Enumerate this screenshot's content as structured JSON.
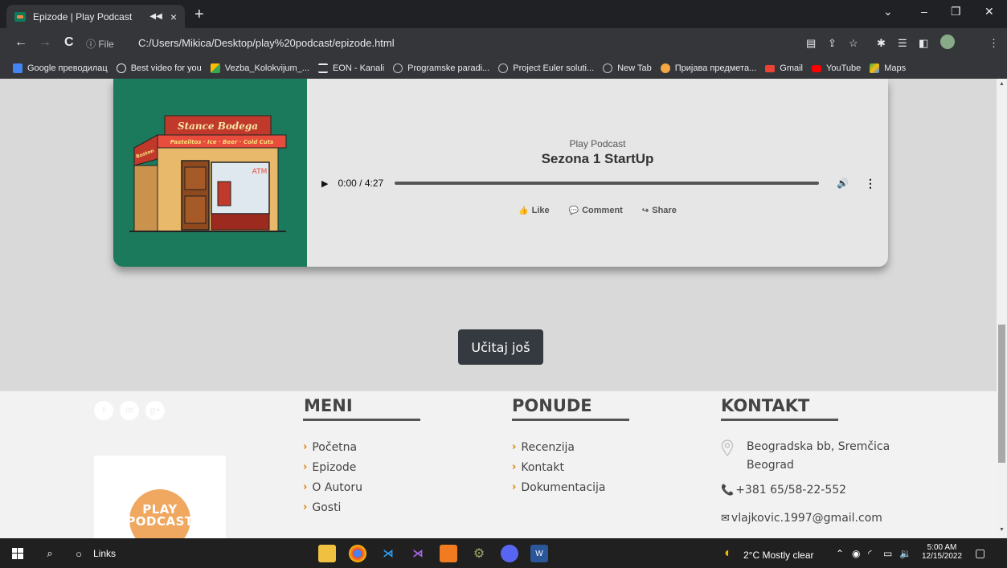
{
  "browser": {
    "tab_title": "Epizode | Play Podcast",
    "tab_audio_icon": "speaker-icon",
    "tab_close": "×",
    "new_tab": "+",
    "window_controls": [
      "⌄",
      "–",
      "❐",
      "✕"
    ],
    "nav": {
      "back": "←",
      "forward": "→",
      "reload": "C"
    },
    "url_info": "ⓘ File",
    "url": "C:/Users/Mikica/Desktop/play%20podcast/epizode.html"
  },
  "bookmarks": [
    {
      "label": "Google преводилац",
      "color": "#4285f4"
    },
    {
      "label": "Best video for you",
      "color": "#35363a"
    },
    {
      "label": "Vezba_Kolokvijum_...",
      "color": "#fbbc04"
    },
    {
      "label": "EON - Kanali",
      "color": "#35363a"
    },
    {
      "label": "Programske paradi...",
      "color": "#35363a"
    },
    {
      "label": "Project Euler soluti...",
      "color": "#35363a"
    },
    {
      "label": "New Tab",
      "color": "#35363a"
    },
    {
      "label": "Пријава предмета...",
      "color": "#f4a742"
    },
    {
      "label": "Gmail",
      "color": "#ea4335"
    },
    {
      "label": "YouTube",
      "color": "#ff0000"
    },
    {
      "label": "Maps",
      "color": "#34a853"
    }
  ],
  "episode": {
    "subtitle": "Play Podcast",
    "title": "Sezona 1 StartUp",
    "audio": {
      "time": "0:00 / 4:27",
      "play": "▶",
      "volume": "🔊",
      "more": "⋮"
    },
    "actions": [
      {
        "icon": "👍",
        "label": "Like"
      },
      {
        "icon": "💬",
        "label": "Comment"
      },
      {
        "icon": "↪",
        "label": "Share"
      }
    ],
    "image_text": {
      "sign": "Stance Bodega",
      "awning": "Pastelitos · Ice · Beer · Cold Cuts",
      "side": "Boston",
      "atm": "ATM"
    }
  },
  "load_more": "Učitaj još",
  "footer": {
    "socials": [
      "f",
      "in",
      "g+"
    ],
    "logo": {
      "line1": "PLAY",
      "line2": "PODCAST"
    },
    "meni": {
      "title": "MENI",
      "items": [
        "Početna",
        "Epizode",
        "O Autoru",
        "Gosti"
      ]
    },
    "ponude": {
      "title": "PONUDE",
      "items": [
        "Recenzija",
        "Kontakt",
        "Dokumentacija"
      ]
    },
    "kontakt": {
      "title": "KONTAKT",
      "address_1": "Beogradska bb, Sremčica",
      "address_2": "Beograd",
      "phone": "+381 65/58-22-552",
      "email": "vlajkovic.1997@gmail.com"
    }
  },
  "taskbar": {
    "search_label": "Links",
    "weather": "2°C  Mostly clear",
    "time": "5:00 AM",
    "date": "12/15/2022"
  }
}
